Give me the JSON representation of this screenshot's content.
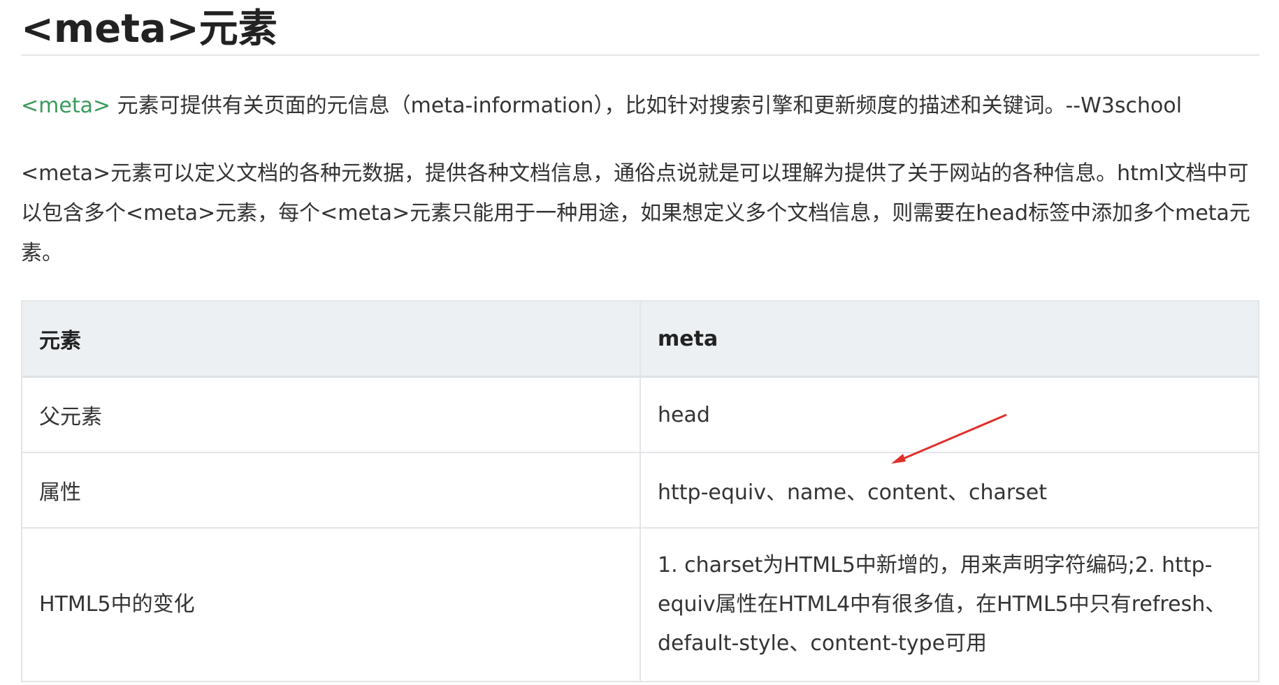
{
  "title": "<meta>元素",
  "intro": {
    "tag": "<meta>",
    "text": " 元素可提供有关页面的元信息（meta-information），比如针对搜索引擎和更新频度的描述和关键词。--W3school"
  },
  "description": "<meta>元素可以定义文档的各种元数据，提供各种文档信息，通俗点说就是可以理解为提供了关于网站的各种信息。html文档中可以包含多个<meta>元素，每个<meta>元素只能用于一种用途，如果想定义多个文档信息，则需要在head标签中添加多个meta元素。",
  "table": {
    "headers": [
      "元素",
      "meta"
    ],
    "rows": [
      [
        "父元素",
        "head"
      ],
      [
        "属性",
        "http-equiv、name、content、charset"
      ],
      [
        "HTML5中的变化",
        "1. charset为HTML5中新增的，用来声明字符编码;2. http-equiv属性在HTML4中有很多值，在HTML5中只有refresh、default-style、content-type可用"
      ]
    ]
  },
  "colors": {
    "tag": "#3a9a5b",
    "annotation_arrow": "#e0302a",
    "header_bg": "#edf0f2"
  }
}
